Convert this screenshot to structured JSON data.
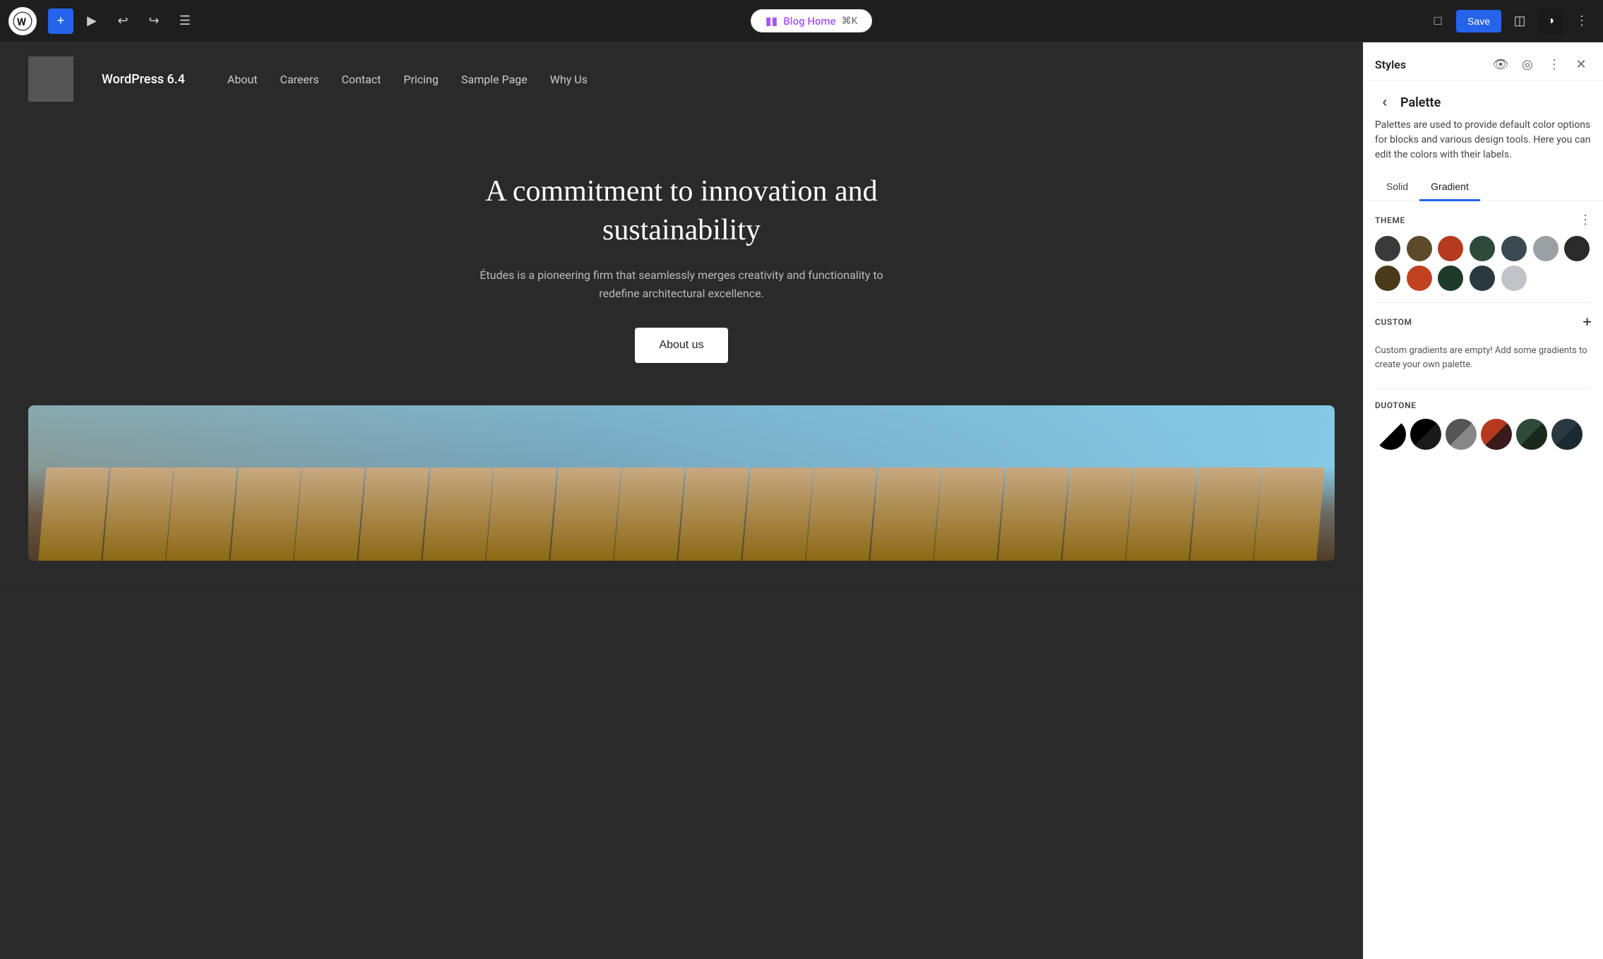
{
  "toolbar": {
    "add_label": "+",
    "blog_home_label": "Blog Home",
    "blog_home_shortcut": "⌘K",
    "save_label": "Save"
  },
  "site": {
    "title": "WordPress 6.4",
    "nav_items": [
      "About",
      "Careers",
      "Contact",
      "Pricing",
      "Sample Page",
      "Why Us"
    ]
  },
  "hero": {
    "heading": "A commitment to innovation and sustainability",
    "description": "Études is a pioneering firm that seamlessly merges creativity and functionality to redefine architectural excellence.",
    "cta_label": "About us"
  },
  "styles_panel": {
    "title": "Styles"
  },
  "palette": {
    "title": "Palette",
    "description": "Palettes are used to provide default color options for blocks and various design tools. Here you can edit the colors with their labels.",
    "tabs": [
      "Solid",
      "Gradient"
    ],
    "active_tab": "Gradient",
    "theme_label": "THEME",
    "custom_label": "CUSTOM",
    "custom_empty_text": "Custom gradients are empty! Add some gradients to create your own palette.",
    "duotone_label": "DUOTONE",
    "theme_colors_row1": [
      {
        "color": "#3a3a3a"
      },
      {
        "color": "#5c4a2a"
      },
      {
        "color": "#b53a1e"
      },
      {
        "color": "#2d4a3a"
      },
      {
        "color": "#3a4a52"
      },
      {
        "color": "#9aA0a4"
      }
    ],
    "theme_colors_row2": [
      {
        "color": "#2a2a2a"
      },
      {
        "color": "#4a3a1a"
      },
      {
        "color": "#c04020"
      },
      {
        "color": "#1e3a28"
      },
      {
        "color": "#2a3840"
      },
      {
        "color": "#c0c4c8"
      }
    ],
    "duotone_swatches": [
      {
        "type": "split",
        "left": "#fff",
        "right": "#000"
      },
      {
        "type": "split",
        "left": "#000",
        "right": "#1a1a1a"
      },
      {
        "type": "split",
        "left": "#555",
        "right": "#888"
      },
      {
        "type": "split",
        "left": "#b53a1e",
        "right": "#3a1a1a"
      },
      {
        "type": "split",
        "left": "#2d4a3a",
        "right": "#1a2a1a"
      },
      {
        "type": "split",
        "left": "#2a3840",
        "right": "#1a2a30"
      }
    ]
  }
}
